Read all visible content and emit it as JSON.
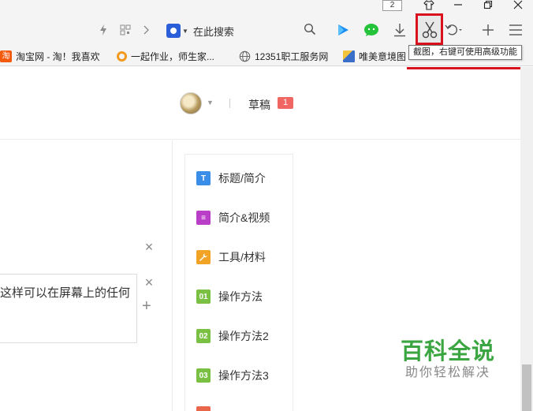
{
  "browser": {
    "window_count": "2",
    "search_placeholder": "在此搜索",
    "tooltip": "截图，右键可使用高级功能",
    "bookmarks": [
      {
        "label": "淘宝网 - 淘！我喜欢",
        "icon": "taobao-icon",
        "color": "#f45a0c"
      },
      {
        "label": "一起作业，师生家...",
        "icon": "yiqi-icon",
        "color": "#f39a1e"
      },
      {
        "label": "12351职工服务网",
        "icon": "globe-icon",
        "color": "#666666"
      },
      {
        "label": "唯美意境图",
        "icon": "image-icon",
        "color": "#3a6fc9"
      }
    ]
  },
  "header": {
    "drafts_label": "草稿",
    "drafts_count": "1"
  },
  "editor": {
    "step_text": "这样可以在屏幕上的任何"
  },
  "outline": {
    "items": [
      {
        "label": "标题/简介",
        "icon_text": "T",
        "color": "#3b8ee8"
      },
      {
        "label": "简介&视频",
        "icon_text": "≡",
        "color": "#b93fc9"
      },
      {
        "label": "工具/材料",
        "icon_text": "🔧",
        "color": "#f1a326"
      },
      {
        "label": "操作方法",
        "icon_text": "01",
        "color": "#7ac143"
      },
      {
        "label": "操作方法2",
        "icon_text": "02",
        "color": "#7ac143"
      },
      {
        "label": "操作方法3",
        "icon_text": "03",
        "color": "#7ac143"
      },
      {
        "label": "",
        "icon_text": "",
        "color": "#e8674a"
      }
    ]
  },
  "watermark": {
    "main": "百科全说",
    "sub": "助你轻松解决"
  },
  "colors": {
    "highlight_red": "#d9101e",
    "watermark_green": "#3ba641"
  }
}
